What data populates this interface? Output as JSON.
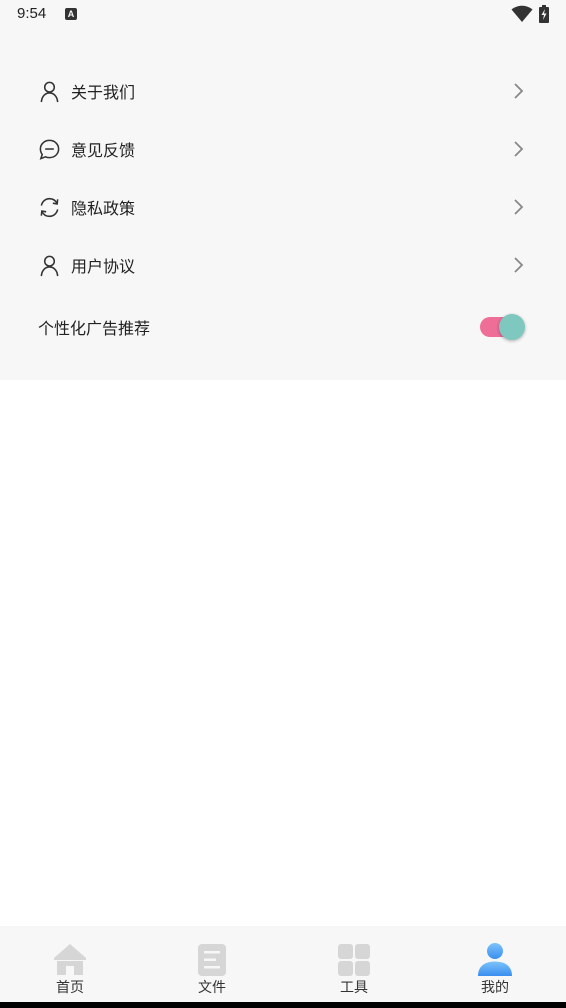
{
  "status_bar": {
    "time": "9:54",
    "notification_icon": "a-icon",
    "wifi_icon": "wifi-icon",
    "battery_icon": "battery-charging-icon"
  },
  "settings": {
    "items": [
      {
        "label": "关于我们",
        "icon": "person-icon"
      },
      {
        "label": "意见反馈",
        "icon": "chat-bubble-icon"
      },
      {
        "label": "隐私政策",
        "icon": "refresh-icon"
      },
      {
        "label": "用户协议",
        "icon": "person-icon"
      }
    ],
    "ad_toggle": {
      "label": "个性化广告推荐",
      "enabled": true
    }
  },
  "colors": {
    "toggle_track": "#ee6e98",
    "toggle_knob": "#7ec8c0",
    "active_tab": "#4a9af5",
    "inactive_tab": "#d6d6d6"
  },
  "bottom_nav": {
    "items": [
      {
        "label": "首页",
        "icon": "home-icon",
        "active": false
      },
      {
        "label": "文件",
        "icon": "document-icon",
        "active": false
      },
      {
        "label": "工具",
        "icon": "grid-icon",
        "active": false
      },
      {
        "label": "我的",
        "icon": "user-icon",
        "active": true
      }
    ]
  }
}
